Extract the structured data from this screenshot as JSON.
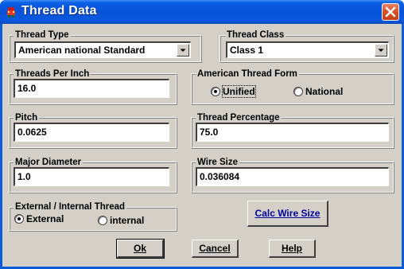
{
  "window": {
    "title": "Thread Data",
    "icon": "app-icon",
    "close_icon": "close-icon"
  },
  "thread_type": {
    "label": "Thread Type",
    "value": "American national Standard"
  },
  "thread_class": {
    "label": "Thread Class",
    "value": "Class 1"
  },
  "threads_per_inch": {
    "label": "Threads Per Inch",
    "value": "16.0"
  },
  "american_thread_form": {
    "label": "American Thread Form",
    "options": [
      "Unified",
      "National"
    ],
    "selected": "Unified"
  },
  "pitch": {
    "label": "Pitch",
    "value": "0.0625"
  },
  "thread_percentage": {
    "label": "Thread Percentage",
    "value": "75.0"
  },
  "major_diameter": {
    "label": "Major Diameter",
    "value": "1.0"
  },
  "wire_size": {
    "label": "Wire Size",
    "value": "0.036084"
  },
  "ext_int_thread": {
    "label": "External / Internal Thread",
    "options": [
      "External",
      "internal"
    ],
    "selected": "External"
  },
  "buttons": {
    "calc_wire_size": "Calc Wire Size",
    "ok": "Ok",
    "cancel": "Cancel",
    "help": "Help"
  },
  "colors": {
    "titlebar": "#0752d6",
    "dialog_face": "#d4d0c8",
    "close_button": "#d9542b",
    "calc_text": "#0000a0"
  }
}
